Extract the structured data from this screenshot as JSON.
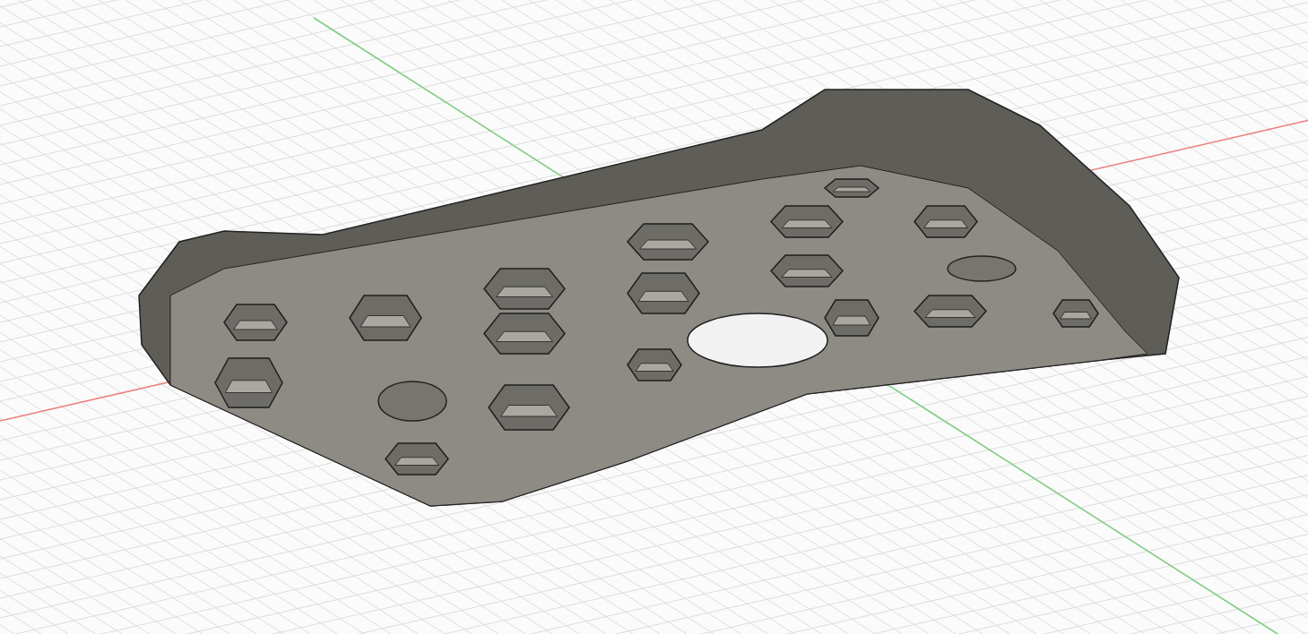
{
  "viewport": {
    "axes": [
      {
        "kind": "x",
        "color": "#f08080"
      },
      {
        "kind": "y",
        "color": "#80d080"
      }
    ]
  }
}
